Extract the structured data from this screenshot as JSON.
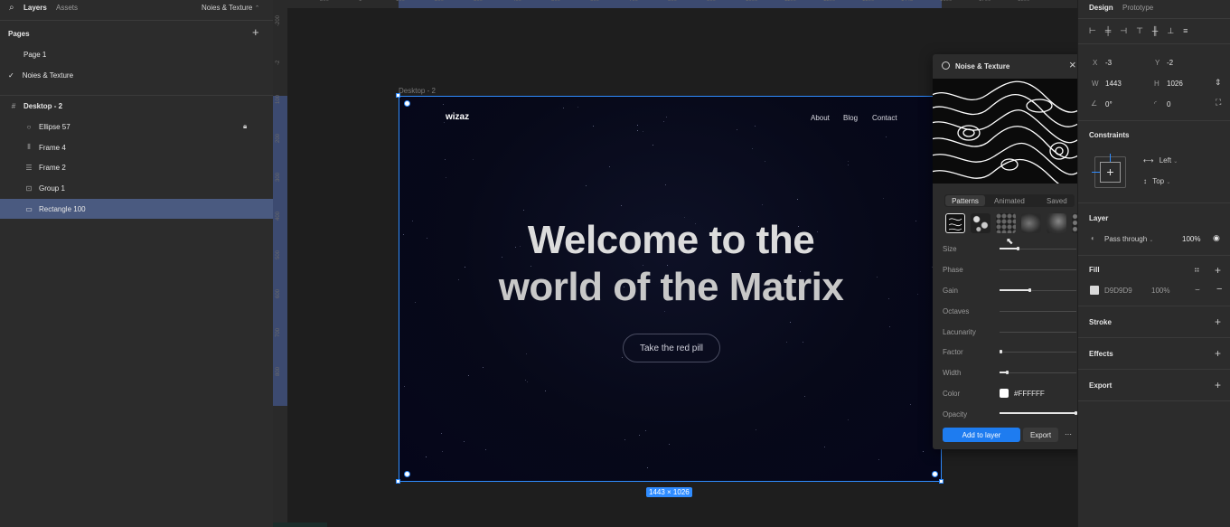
{
  "left_panel": {
    "tabs": {
      "layers": "Layers",
      "assets": "Assets"
    },
    "current_page": "Noies & Texture",
    "pages_title": "Pages",
    "pages": [
      "Page 1",
      "Noies & Texture"
    ],
    "frame_name": "Desktop - 2",
    "layers": [
      {
        "name": "Ellipse 57",
        "icon": "ellipse-icon",
        "locked": true
      },
      {
        "name": "Frame 4",
        "icon": "frame-columns-icon",
        "locked": false
      },
      {
        "name": "Frame 2",
        "icon": "frame-rows-icon",
        "locked": false
      },
      {
        "name": "Group 1",
        "icon": "group-icon",
        "locked": false
      },
      {
        "name": "Rectangle 100",
        "icon": "rectangle-icon",
        "locked": false,
        "selected": true
      }
    ]
  },
  "canvas": {
    "ruler_top_ticks": [
      "-200",
      "-1",
      "100",
      "200",
      "300",
      "400",
      "500",
      "600",
      "700",
      "800",
      "900",
      "1000",
      "1100",
      "1200",
      "1300",
      "1443",
      "1600",
      "1700",
      "1800"
    ],
    "ruler_left_ticks": [
      "-200",
      "-2",
      "100",
      "200",
      "300",
      "400",
      "500",
      "600",
      "700",
      "800"
    ],
    "frame_label": "Desktop - 2",
    "size_badge": "1443 × 1026",
    "site": {
      "logo": "wizaz",
      "nav": [
        "About",
        "Blog",
        "Contact"
      ],
      "heading_line1": "Welcome to the",
      "heading_line2": "world of the Matrix",
      "cta": "Take the red pill"
    }
  },
  "plugin": {
    "title": "Noise & Texture",
    "tabs": [
      "Patterns",
      "Animated",
      "Saved"
    ],
    "active_tab": "Patterns",
    "params": [
      {
        "label": "Size",
        "value": 0.25
      },
      {
        "label": "Phase",
        "value": 0
      },
      {
        "label": "Gain",
        "value": 0.4
      },
      {
        "label": "Octaves",
        "value": 0
      },
      {
        "label": "Lacunarity",
        "value": 0
      },
      {
        "label": "Factor",
        "value": 0.02
      },
      {
        "label": "Width",
        "value": 0.1
      },
      {
        "label": "Color",
        "value": "#FFFFFF"
      },
      {
        "label": "Opacity",
        "value": 1.0
      }
    ],
    "color_value": "#FFFFFF",
    "add_button": "Add to layer",
    "export_button": "Export",
    "more": "···"
  },
  "right_panel": {
    "tabs": {
      "design": "Design",
      "prototype": "Prototype"
    },
    "x_label": "X",
    "x_value": "-3",
    "y_label": "Y",
    "y_value": "-2",
    "w_label": "W",
    "w_value": "1443",
    "h_label": "H",
    "h_value": "1026",
    "rotation": "0°",
    "radius": "0",
    "constraints_title": "Constraints",
    "constraint_h": "Left",
    "constraint_v": "Top",
    "layer_title": "Layer",
    "blend_mode": "Pass through",
    "layer_opacity": "100%",
    "fill_title": "Fill",
    "fill_hex": "D9D9D9",
    "fill_opacity": "100%",
    "stroke_title": "Stroke",
    "effects_title": "Effects",
    "export_title": "Export"
  },
  "colors": {
    "accent": "#2f8cff",
    "panel": "#2c2c2c",
    "canvas": "#1e1e1e",
    "selected_row": "#4a5a80",
    "add_button": "#1e7cf0",
    "fill_swatch": "#d9d9d9"
  }
}
